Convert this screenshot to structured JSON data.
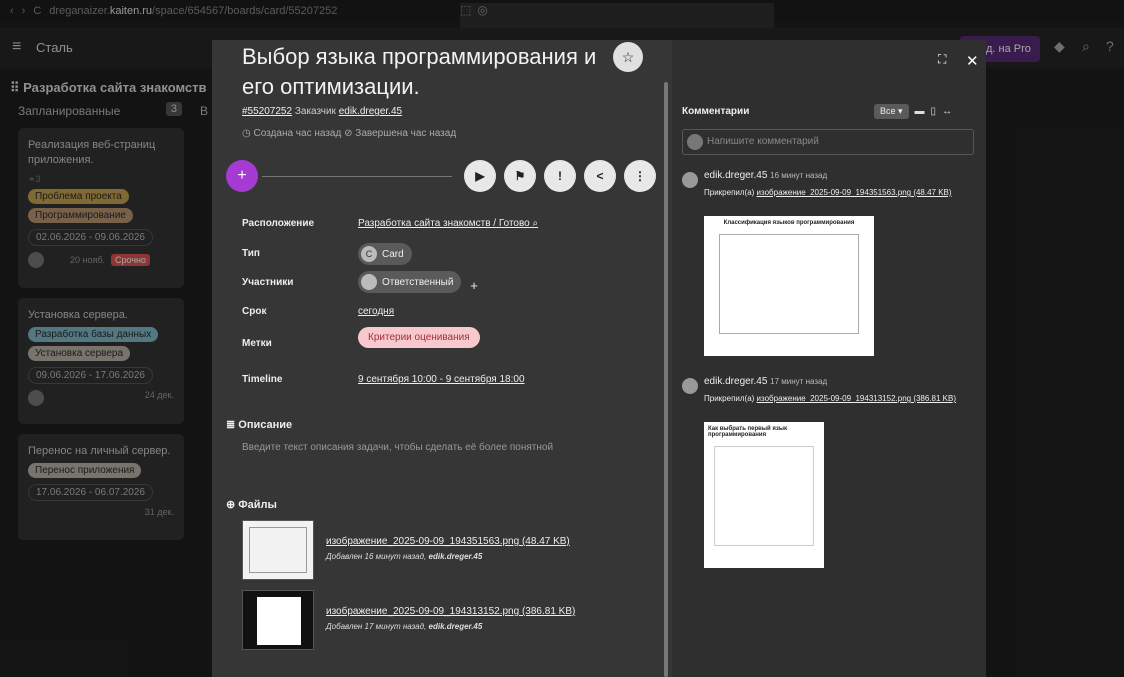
{
  "browser": {
    "url_prefix": "dreganaizer.",
    "url_host": "kaiten.ru",
    "url_path": "/space/654567/boards/card/55207252"
  },
  "topbar": {
    "space_name": "Сталь",
    "pro_label": "д. на Pro"
  },
  "board": {
    "column_title": "Разработка сайта знакомств",
    "lane": {
      "title": "Запланированные",
      "count": "3"
    },
    "next_lane_letter": "В р",
    "cards": [
      {
        "title": "Реализация веб-страниц приложения.",
        "sub": "3",
        "tags": [
          "Проблема проекта",
          "Программирование"
        ],
        "dates": "02.06.2026 - 09.06.2026",
        "due": "20 нояб.",
        "urgent": "Срочно"
      },
      {
        "title": "Установка сервера.",
        "tags": [
          "Разработка базы данных",
          "Установка сервера"
        ],
        "dates": "09.06.2026 - 17.06.2026",
        "due": "24 дек."
      },
      {
        "title": "Перенос на личный сервер.",
        "tags": [
          "Перенос приложения"
        ],
        "dates": "17.06.2026 - 06.07.2026",
        "due": "31 дек."
      }
    ]
  },
  "card": {
    "title": "Выбор языка программирования и его оптимизации.",
    "id": "#55207252",
    "customer_label": "Заказчик",
    "customer": "edik.dreger.45",
    "created": "Создана час назад",
    "completed": "Завершена час назад",
    "props": {
      "location_label": "Расположение",
      "location_value": "Разработка сайта знакомств / Готово",
      "type_label": "Тип",
      "type_value": "Card",
      "type_initial": "C",
      "members_label": "Участники",
      "members_value": "Ответственный",
      "due_label": "Срок",
      "due_value": "сегодня",
      "tags_label": "Метки",
      "tags_value": "Критерии оценивания",
      "timeline_label": "Timeline",
      "timeline_value": "9 сентября 10:00 - 9 сентября 18:00"
    },
    "description": {
      "title": "Описание",
      "placeholder": "Введите текст описания задачи, чтобы сделать её более понятной"
    },
    "files": {
      "title": "Файлы",
      "items": [
        {
          "name": "изображение_2025-09-09_194351563.png (48.47 KB)",
          "meta_prefix": "Добавлен 16 минут назад,",
          "author": "edik.dreger.45"
        },
        {
          "name": "изображение_2025-09-09_194313152.png (386.81 KB)",
          "meta_prefix": "Добавлен 17 минут назад,",
          "author": "edik.dreger.45"
        }
      ]
    }
  },
  "comments": {
    "title": "Комментарии",
    "filter": "Все",
    "placeholder": "Напишите комментарий",
    "items": [
      {
        "author": "edik.dreger.45",
        "time": "16 минут назад",
        "attach_prefix": "Прикрепил(а)",
        "file": "изображение_2025-09-09_194351563.png (48.47 KB)",
        "image_caption": "Классификация языков программирования"
      },
      {
        "author": "edik.dreger.45",
        "time": "17 минут назад",
        "attach_prefix": "Прикрепил(а)",
        "file": "изображение_2025-09-09_194313152.png (386.81 KB)",
        "image_caption": "Как выбрать первый язык программирования"
      }
    ]
  },
  "colors": {
    "accent": "#a53bd2",
    "pink_tag": "#f7c9ce",
    "modal_bg": "#363636"
  }
}
